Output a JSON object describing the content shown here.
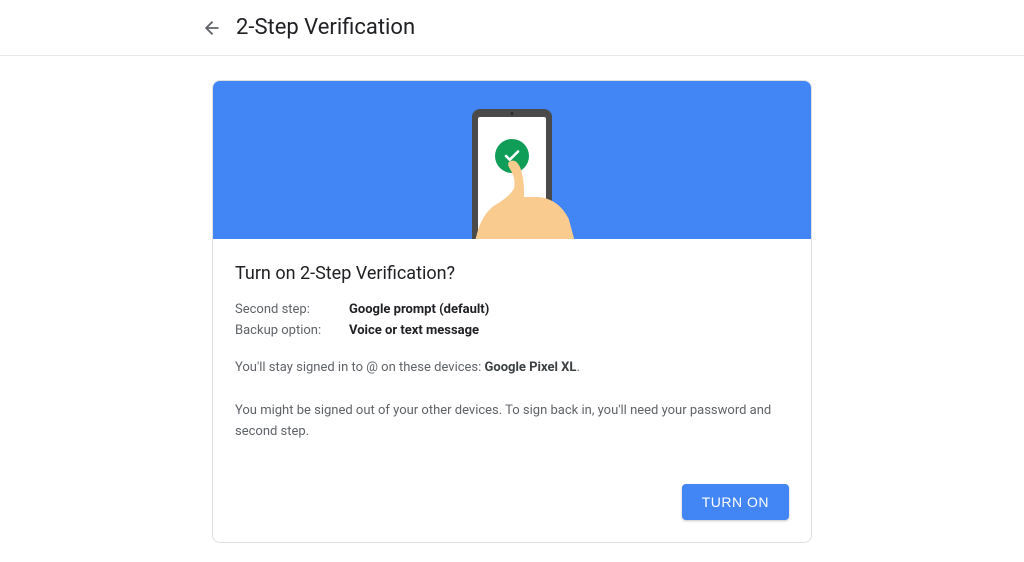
{
  "header": {
    "title": "2-Step Verification"
  },
  "card": {
    "heading": "Turn on 2-Step Verification?",
    "second_step_label": "Second step:",
    "second_step_value": "Google prompt (default)",
    "backup_label": "Backup option:",
    "backup_value": "Voice or text message",
    "signed_in_prefix": "You'll stay signed in to ",
    "signed_in_email": "@",
    "signed_in_middle": " on these devices: ",
    "signed_in_device": "Google Pixel XL",
    "signed_in_suffix": ".",
    "note": "You might be signed out of your other devices. To sign back in, you'll need your password and second step.",
    "turn_on_label": "TURN ON"
  }
}
